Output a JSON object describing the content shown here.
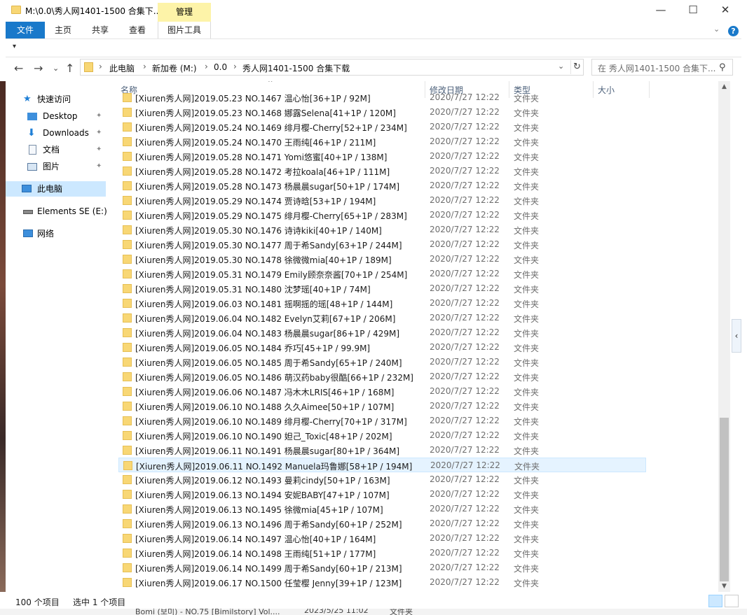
{
  "window": {
    "title": "M:\\0.0\\秀人网1401-1500 合集下...",
    "manage_tab": "管理",
    "controls": {
      "minimize": "—",
      "maximize": "☐",
      "close": "✕"
    }
  },
  "ribbon": {
    "tabs": [
      "文件",
      "主页",
      "共享",
      "查看",
      "图片工具"
    ],
    "collapse": "⌄",
    "help": "?"
  },
  "qat": {
    "symbol": "▾"
  },
  "address": {
    "crumbs": [
      "此电脑",
      "新加卷 (M:)",
      "0.0",
      "秀人网1401-1500 合集下载"
    ],
    "back": "←",
    "forward": "→",
    "recent": "⌄",
    "up": "↑",
    "dropdown": "⌄",
    "refresh": "↻"
  },
  "search": {
    "placeholder": "在 秀人网1401-1500 合集下...",
    "icon": "⚲"
  },
  "nav": {
    "items": [
      {
        "label": "快速访问",
        "icon": "star-icon"
      },
      {
        "label": "Desktop",
        "icon": "desktop-icon",
        "pinned": true
      },
      {
        "label": "Downloads",
        "icon": "download-icon",
        "pinned": true
      },
      {
        "label": "文档",
        "icon": "document-icon",
        "pinned": true
      },
      {
        "label": "图片",
        "icon": "picture-icon",
        "pinned": true
      },
      {
        "label": "此电脑",
        "icon": "computer-icon",
        "selected": true
      },
      {
        "label": "Elements SE (E:)",
        "icon": "drive-icon"
      },
      {
        "label": "网络",
        "icon": "network-icon"
      }
    ],
    "pin": "📌"
  },
  "columns": {
    "name": "名称",
    "date": "修改日期",
    "type": "类型",
    "size": "大小",
    "sort": "^"
  },
  "files": [
    {
      "name": "[Xiuren秀人网]2019.05.23 NO.1467 温心怡[36+1P / 92M]",
      "date": "2020/7/27 12:22",
      "type": "文件夹"
    },
    {
      "name": "[Xiuren秀人网]2019.05.23 NO.1468 娜露Selena[41+1P / 120M]",
      "date": "2020/7/27 12:22",
      "type": "文件夹"
    },
    {
      "name": "[Xiuren秀人网]2019.05.24 NO.1469 绯月樱-Cherry[52+1P / 234M]",
      "date": "2020/7/27 12:22",
      "type": "文件夹"
    },
    {
      "name": "[Xiuren秀人网]2019.05.24 NO.1470 王雨纯[46+1P / 211M]",
      "date": "2020/7/27 12:22",
      "type": "文件夹"
    },
    {
      "name": "[Xiuren秀人网]2019.05.28 NO.1471 Yomi悠蜜[40+1P / 138M]",
      "date": "2020/7/27 12:22",
      "type": "文件夹"
    },
    {
      "name": "[Xiuren秀人网]2019.05.28 NO.1472 考拉koala[46+1P / 111M]",
      "date": "2020/7/27 12:22",
      "type": "文件夹"
    },
    {
      "name": "[Xiuren秀人网]2019.05.28 NO.1473 杨晨晨sugar[50+1P / 174M]",
      "date": "2020/7/27 12:22",
      "type": "文件夹"
    },
    {
      "name": "[Xiuren秀人网]2019.05.29 NO.1474 贾诗晗[53+1P / 194M]",
      "date": "2020/7/27 12:22",
      "type": "文件夹"
    },
    {
      "name": "[Xiuren秀人网]2019.05.29 NO.1475 绯月樱-Cherry[65+1P / 283M]",
      "date": "2020/7/27 12:22",
      "type": "文件夹"
    },
    {
      "name": "[Xiuren秀人网]2019.05.30 NO.1476 诗诗kiki[40+1P / 140M]",
      "date": "2020/7/27 12:22",
      "type": "文件夹"
    },
    {
      "name": "[Xiuren秀人网]2019.05.30 NO.1477 周于希Sandy[63+1P / 244M]",
      "date": "2020/7/27 12:22",
      "type": "文件夹"
    },
    {
      "name": "[Xiuren秀人网]2019.05.30 NO.1478 徐微微mia[40+1P / 189M]",
      "date": "2020/7/27 12:22",
      "type": "文件夹"
    },
    {
      "name": "[Xiuren秀人网]2019.05.31 NO.1479 Emily顾奈奈酱[70+1P / 254M]",
      "date": "2020/7/27 12:22",
      "type": "文件夹"
    },
    {
      "name": "[Xiuren秀人网]2019.05.31 NO.1480 沈梦瑶[40+1P / 74M]",
      "date": "2020/7/27 12:22",
      "type": "文件夹"
    },
    {
      "name": "[Xiuren秀人网]2019.06.03 NO.1481 摇啊摇的瑶[48+1P / 144M]",
      "date": "2020/7/27 12:22",
      "type": "文件夹"
    },
    {
      "name": "[Xiuren秀人网]2019.06.04 NO.1482 Evelyn艾莉[67+1P / 206M]",
      "date": "2020/7/27 12:22",
      "type": "文件夹"
    },
    {
      "name": "[Xiuren秀人网]2019.06.04 NO.1483 杨晨晨sugar[86+1P / 429M]",
      "date": "2020/7/27 12:22",
      "type": "文件夹"
    },
    {
      "name": "[Xiuren秀人网]2019.06.05 NO.1484 乔巧[45+1P / 99.9M]",
      "date": "2020/7/27 12:22",
      "type": "文件夹"
    },
    {
      "name": "[Xiuren秀人网]2019.06.05 NO.1485 周于希Sandy[65+1P / 240M]",
      "date": "2020/7/27 12:22",
      "type": "文件夹"
    },
    {
      "name": "[Xiuren秀人网]2019.06.05 NO.1486 萌汉药baby很酷[66+1P / 232M]",
      "date": "2020/7/27 12:22",
      "type": "文件夹"
    },
    {
      "name": "[Xiuren秀人网]2019.06.06 NO.1487 冯木木LRIS[46+1P / 168M]",
      "date": "2020/7/27 12:22",
      "type": "文件夹"
    },
    {
      "name": "[Xiuren秀人网]2019.06.10 NO.1488 久久Aimee[50+1P / 107M]",
      "date": "2020/7/27 12:22",
      "type": "文件夹"
    },
    {
      "name": "[Xiuren秀人网]2019.06.10 NO.1489 绯月樱-Cherry[70+1P / 317M]",
      "date": "2020/7/27 12:22",
      "type": "文件夹"
    },
    {
      "name": "[Xiuren秀人网]2019.06.10 NO.1490 妲己_Toxic[48+1P / 202M]",
      "date": "2020/7/27 12:22",
      "type": "文件夹"
    },
    {
      "name": "[Xiuren秀人网]2019.06.11 NO.1491 杨晨晨sugar[80+1P / 364M]",
      "date": "2020/7/27 12:22",
      "type": "文件夹"
    },
    {
      "name": "[Xiuren秀人网]2019.06.11 NO.1492 Manuela玛鲁娜[58+1P / 194M]",
      "date": "2020/7/27 12:22",
      "type": "文件夹",
      "selected": true
    },
    {
      "name": "[Xiuren秀人网]2019.06.12 NO.1493 曼莉cindy[50+1P / 163M]",
      "date": "2020/7/27 12:22",
      "type": "文件夹"
    },
    {
      "name": "[Xiuren秀人网]2019.06.13 NO.1494 安妮BABY[47+1P / 107M]",
      "date": "2020/7/27 12:22",
      "type": "文件夹"
    },
    {
      "name": "[Xiuren秀人网]2019.06.13 NO.1495 徐微mia[45+1P / 107M]",
      "date": "2020/7/27 12:22",
      "type": "文件夹"
    },
    {
      "name": "[Xiuren秀人网]2019.06.13 NO.1496 周于希Sandy[60+1P / 252M]",
      "date": "2020/7/27 12:22",
      "type": "文件夹"
    },
    {
      "name": "[Xiuren秀人网]2019.06.14 NO.1497 温心怡[40+1P / 164M]",
      "date": "2020/7/27 12:22",
      "type": "文件夹"
    },
    {
      "name": "[Xiuren秀人网]2019.06.14 NO.1498 王雨纯[51+1P / 177M]",
      "date": "2020/7/27 12:22",
      "type": "文件夹"
    },
    {
      "name": "[Xiuren秀人网]2019.06.14 NO.1499 周于希Sandy[60+1P / 213M]",
      "date": "2020/7/27 12:22",
      "type": "文件夹"
    },
    {
      "name": "[Xiuren秀人网]2019.06.17 NO.1500 任莹樱 Jenny[39+1P / 123M]",
      "date": "2020/7/27 12:22",
      "type": "文件夹"
    }
  ],
  "scrollbar": {
    "up": "▲",
    "down": "▼",
    "position_fraction": 0.68
  },
  "collapse_tab": "‹",
  "status": {
    "count": "100 个项目",
    "selected": "选中 1 个项目"
  },
  "behind_window": {
    "name": "Bomi (보미) - NO.75 [Bimilstory] Vol....",
    "date": "2023/5/25 11:02",
    "type": "文件夹"
  }
}
